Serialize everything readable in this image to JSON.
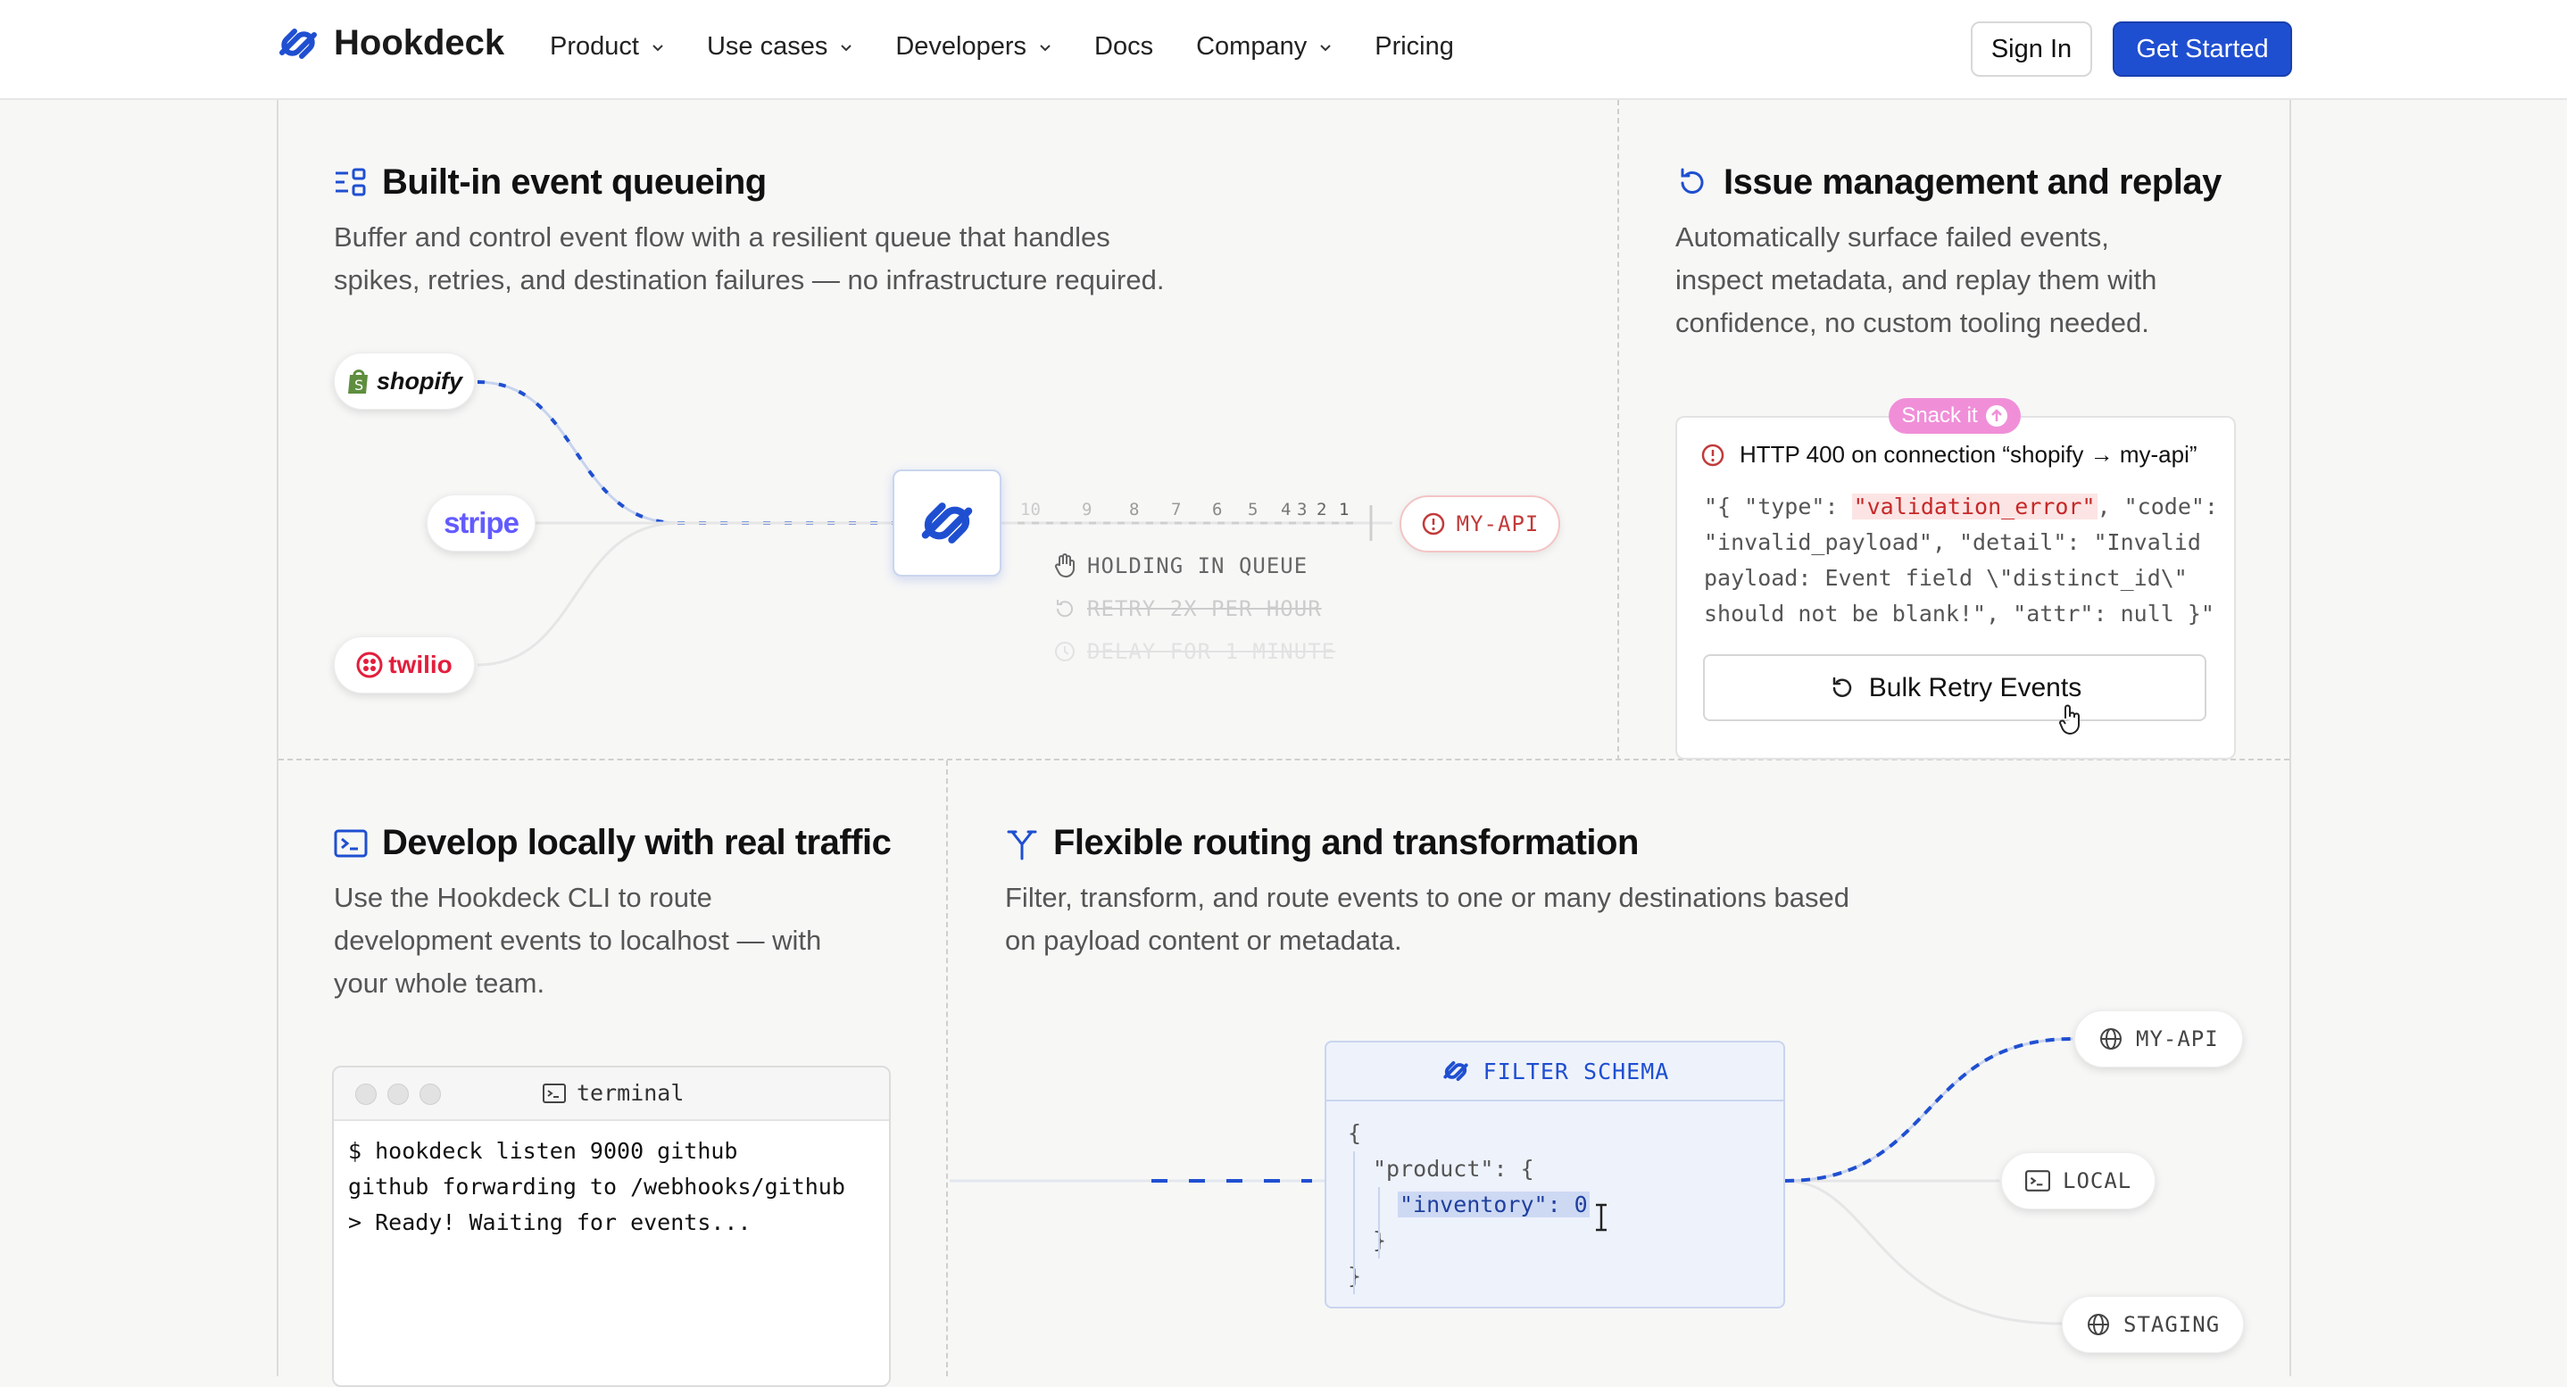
{
  "nav": {
    "brand": "Hookdeck",
    "menu": [
      {
        "label": "Product",
        "dropdown": true
      },
      {
        "label": "Use cases",
        "dropdown": true
      },
      {
        "label": "Developers",
        "dropdown": true
      },
      {
        "label": "Docs",
        "dropdown": false
      },
      {
        "label": "Company",
        "dropdown": true
      },
      {
        "label": "Pricing",
        "dropdown": false
      }
    ],
    "sign_in": "Sign In",
    "get_started": "Get Started"
  },
  "queueing": {
    "title": "Built-in event queueing",
    "desc_line1": "Buffer and control event flow with a resilient queue that handles",
    "desc_line2": "spikes, retries, and destination failures — no infrastructure required.",
    "sources": [
      "shopify",
      "stripe",
      "twilio"
    ],
    "queue_numbers": [
      "10",
      "9",
      "8",
      "7",
      "6",
      "5",
      "4",
      "3",
      "2",
      "1"
    ],
    "destination": "MY-API",
    "statuses": [
      {
        "label": "HOLDING IN QUEUE",
        "icon": "hand-icon",
        "state": "active"
      },
      {
        "label": "RETRY 2X PER HOUR",
        "icon": "retry-icon",
        "state": "disabled"
      },
      {
        "label": "DELAY FOR 1 MINUTE",
        "icon": "clock-icon",
        "state": "disabled"
      }
    ]
  },
  "issues": {
    "title": "Issue management and replay",
    "desc_line1": "Automatically surface failed events,",
    "desc_line2": "inspect metadata, and replay them with",
    "desc_line3": "confidence, no custom tooling needed.",
    "snack_label": "Snack it",
    "error_title": "HTTP 400 on connection “shopify → my-api”",
    "code": {
      "l1_pre": "\"{ \"type\": ",
      "l1_hl": "\"validation_error\"",
      "l1_post": ", \"code\":",
      "l2": "\"invalid_payload\", \"detail\": \"Invalid",
      "l3": "payload: Event field \\\"distinct_id\\\"",
      "l4": "should not be blank!\", \"attr\": null }\""
    },
    "bulk_retry": "Bulk Retry Events"
  },
  "develop": {
    "title": "Develop locally with real traffic",
    "desc_line1": "Use the Hookdeck CLI to route",
    "desc_line2": "development events to localhost — with",
    "desc_line3": "your whole team.",
    "terminal_title": "terminal",
    "terminal_lines": [
      "$ hookdeck listen 9000 github",
      "github forwarding to /webhooks/github",
      "> Ready! Waiting for events..."
    ]
  },
  "routing": {
    "title": "Flexible routing and transformation",
    "desc_line1": "Filter, transform, and route events to one or many destinations based",
    "desc_line2": "on payload content or metadata.",
    "schema_title": "FILTER SCHEMA",
    "schema_lines": [
      "{",
      "\"product\": {",
      "\"inventory\": 0",
      "}",
      "}"
    ],
    "destinations": [
      "MY-API",
      "LOCAL",
      "STAGING"
    ]
  },
  "colors": {
    "accent": "#1f4fd1",
    "error": "#c23a3a",
    "snack": "#f08fd8"
  }
}
